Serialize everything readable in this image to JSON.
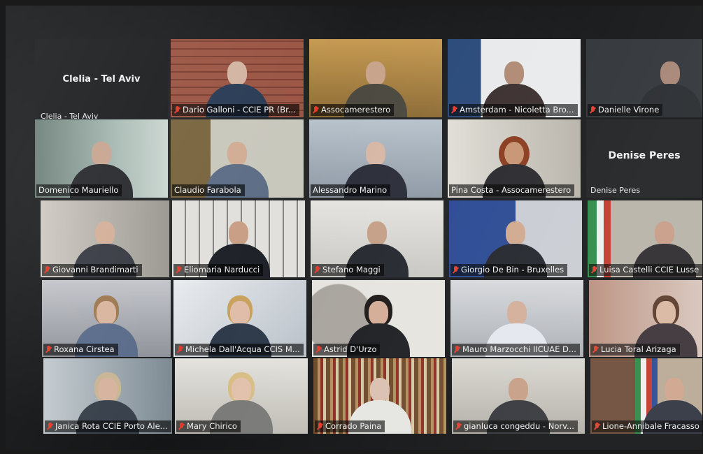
{
  "labels": {
    "clelia_big": "Clelia - Tel Aviv",
    "clelia_small": "Clelia - Tel Aviv",
    "denise_big": "Denise Peres",
    "denise_small": "Denise Peres"
  },
  "tiles": {
    "r1c2": "Dario Galloni - CCIE PR (Br...",
    "r1c3": "Assocamerestero",
    "r1c4": "Amsterdam - Nicoletta Bro...",
    "r1c5": "Danielle Virone",
    "r2c1": "Domenico Mauriello",
    "r2c2": "Claudio Farabola",
    "r2c3": "Alessandro Marino",
    "r2c4": "Pina Costa - Assocamerestero",
    "r3c1": "Giovanni Brandimarti",
    "r3c2": "Eliomaria Narducci",
    "r3c3": "Stefano Maggi",
    "r3c4": "Giorgio De Bin - Bruxelles",
    "r3c5": "Luisa Castelli CCIE Lusse",
    "r4c1": "Roxana Cirstea",
    "r4c2": "Michela Dall'Acqua CCIS M...",
    "r4c3": "Astrid D'Urzo",
    "r4c4": "Mauro Marzocchi IICUAE D...",
    "r4c5": "Lucia Toral Arizaga",
    "r5c1": "Janica Rota CCIE Porto Ale...",
    "r5c2": "Mary Chirico",
    "r5c3": "Corrado Paina",
    "r5c4": "gianluca congeddu - Norv...",
    "r5c5": "Lione-Annibale Fracasso"
  },
  "colors": {
    "muted_mic": "#e23b2e",
    "active_speaker_border": "#e6d23c",
    "name_bar_bg": "#000000"
  },
  "icons": {
    "muted": "mic-muted-icon"
  }
}
